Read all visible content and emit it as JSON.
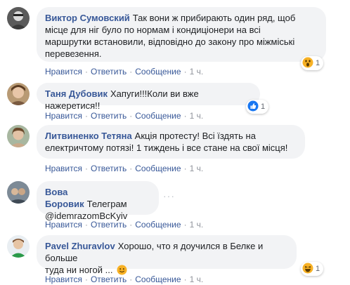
{
  "comments": [
    {
      "author": "Виктор Сумовский",
      "text_lines": [
        "Так вони ж прибирають один ряд, щоб",
        "місце для ніг було по нормам і кондиціонери на всі",
        "маршрутки встановили, відповідно до закону про міжміські",
        "перевезення."
      ],
      "actions": [
        "Нравится",
        "Ответить",
        "Сообщение"
      ],
      "time": "1 ч.",
      "reaction": {
        "icon": "wow-emoji-icon",
        "count": "1"
      }
    },
    {
      "author": "Таня Дубовик",
      "text_lines": [
        "Хапуги!!!Коли ви вже нажеретися!!"
      ],
      "actions": [
        "Нравится",
        "Ответить",
        "Сообщение"
      ],
      "time": "1 ч.",
      "reaction": {
        "icon": "like-icon",
        "count": "1"
      }
    },
    {
      "author": "Литвиненко Тетяна",
      "text_lines": [
        "Акція протесту! Всі їздять на",
        "електричтому потязі! 1 тиждень і все стане на свої місця!"
      ],
      "actions": [
        "Нравится",
        "Ответить",
        "Сообщение"
      ],
      "time": "1 ч."
    },
    {
      "author": "Вова Боровик",
      "text_lines": [
        "Телеграм",
        "@idemrazomBcKyiv"
      ],
      "actions": [
        "Нравится",
        "Ответить",
        "Сообщение"
      ],
      "time": "1 ч."
    },
    {
      "author": "Pavel Zhuravlov",
      "text_lines": [
        "Хорошо, что я доучился в Белке и больше",
        "туда ни ногой ..."
      ],
      "actions": [
        "Нравится",
        "Ответить",
        "Сообщение"
      ],
      "time": "1 ч.",
      "reaction": {
        "icon": "haha-emoji-icon",
        "count": "1"
      }
    }
  ],
  "colors": {
    "author": "#385898",
    "bubble": "#f2f3f5",
    "meta": "#90949c",
    "like_blue": "#1877f2",
    "emoji_yellow": "#f7b125"
  }
}
